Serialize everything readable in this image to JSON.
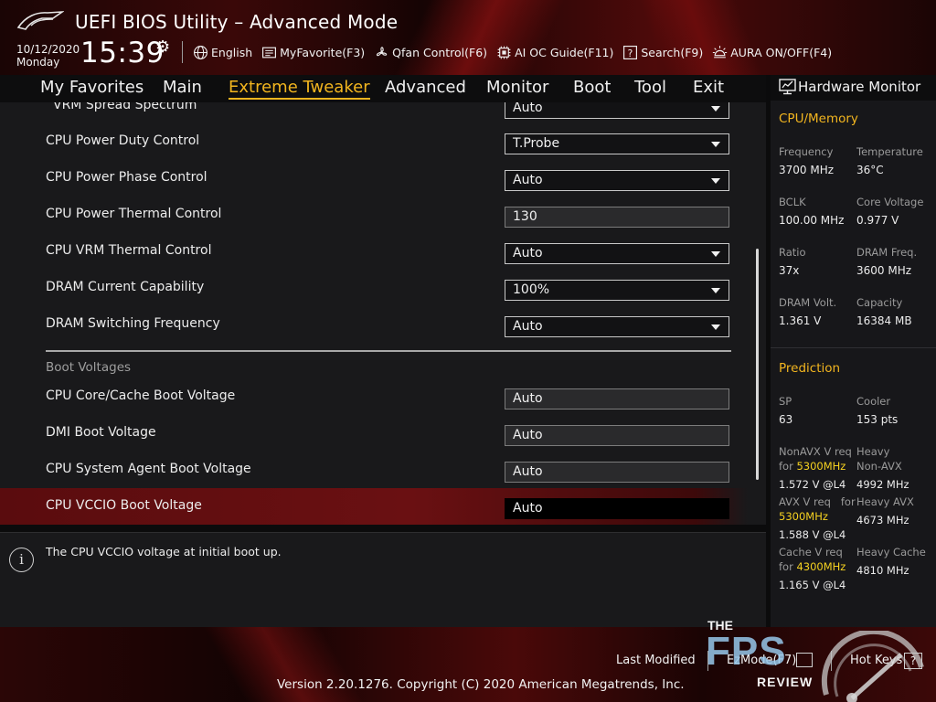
{
  "header": {
    "app_title": "UEFI BIOS Utility – Advanced Mode",
    "date": "10/12/2020",
    "day": "Monday",
    "time": "15:39",
    "toolbar": [
      {
        "id": "language",
        "label": "English",
        "icon": "globe-icon"
      },
      {
        "id": "myfavorite",
        "label": "MyFavorite(F3)",
        "icon": "favorite-list-icon"
      },
      {
        "id": "qfan",
        "label": "Qfan Control(F6)",
        "icon": "fan-icon"
      },
      {
        "id": "aioc",
        "label": "AI OC Guide(F11)",
        "icon": "chip-icon"
      },
      {
        "id": "search",
        "label": "Search(F9)",
        "icon": "question-box-icon"
      },
      {
        "id": "aura",
        "label": "AURA ON/OFF(F4)",
        "icon": "light-icon"
      }
    ]
  },
  "nav": {
    "tabs": [
      "My Favorites",
      "Main",
      "Extreme Tweaker",
      "Advanced",
      "Monitor",
      "Boot",
      "Tool",
      "Exit"
    ],
    "active": "Extreme Tweaker"
  },
  "settings": {
    "partial_row": {
      "label": "VRM Spread Spectrum",
      "value": "Auto"
    },
    "rows": [
      {
        "label": "CPU Power Duty Control",
        "value": "T.Probe"
      },
      {
        "label": "CPU Power Phase Control",
        "value": "Auto"
      },
      {
        "label": "CPU Power Thermal Control",
        "value": "130"
      },
      {
        "label": "CPU VRM Thermal Control",
        "value": "Auto"
      },
      {
        "label": "DRAM Current Capability",
        "value": "100%"
      },
      {
        "label": "DRAM Switching Frequency",
        "value": "Auto"
      }
    ],
    "section_title": "Boot Voltages",
    "boot_rows": [
      {
        "label": "CPU Core/Cache Boot Voltage",
        "value": "Auto"
      },
      {
        "label": "DMI Boot Voltage",
        "value": "Auto"
      },
      {
        "label": "CPU System Agent Boot Voltage",
        "value": "Auto"
      },
      {
        "label": "CPU VCCIO Boot Voltage",
        "value": "Auto"
      }
    ]
  },
  "help": {
    "text": "The CPU VCCIO voltage at initial boot up."
  },
  "hardware_monitor": {
    "title": "Hardware Monitor",
    "cpu_memory": {
      "title": "CPU/Memory",
      "frequency_label": "Frequency",
      "frequency_value": "3700 MHz",
      "temperature_label": "Temperature",
      "temperature_value": "36°C",
      "bclk_label": "BCLK",
      "bclk_value": "100.00 MHz",
      "core_voltage_label": "Core Voltage",
      "core_voltage_value": "0.977 V",
      "ratio_label": "Ratio",
      "ratio_value": "37x",
      "dram_freq_label": "DRAM Freq.",
      "dram_freq_value": "3600 MHz",
      "dram_volt_label": "DRAM Volt.",
      "dram_volt_value": "1.361 V",
      "capacity_label": "Capacity",
      "capacity_value": "16384 MB"
    },
    "prediction": {
      "title": "Prediction",
      "sp_label": "SP",
      "sp_value": "63",
      "cooler_label": "Cooler",
      "cooler_value": "153 pts",
      "nonavx_req_line1": "NonAVX V req",
      "nonavx_req_for": "for",
      "nonavx_req_freq": "5300MHz",
      "nonavx_req_value": "1.572 V @L4",
      "heavy_nonavx_line1": "Heavy",
      "heavy_nonavx_line2": "Non-AVX",
      "heavy_nonavx_value": "4992 MHz",
      "avx_req_line1": "AVX V req",
      "avx_req_for": "for",
      "avx_req_freq": "5300MHz",
      "avx_req_value": "1.588 V @L4",
      "heavy_avx_label": "Heavy AVX",
      "heavy_avx_value": "4673 MHz",
      "cache_req_line1": "Cache V req",
      "cache_req_for": "for",
      "cache_req_freq": "4300MHz",
      "cache_req_value": "1.165 V @L4",
      "heavy_cache_label": "Heavy Cache",
      "heavy_cache_value": "4810 MHz"
    }
  },
  "footer": {
    "last_modified": "Last Modified",
    "ez_mode": "EzMode(F7)",
    "hot_keys": "Hot Keys",
    "hot_keys_key": "?",
    "version": "Version 2.20.1276. Copyright (C) 2020 American Megatrends, Inc."
  },
  "watermark": {
    "line1": "THE",
    "line2": "FPS",
    "line3": "REVIEW"
  },
  "colors": {
    "accent": "#f2b51f",
    "selected_row": "#5a0c0e",
    "highlight_freq": "#f4d020"
  }
}
